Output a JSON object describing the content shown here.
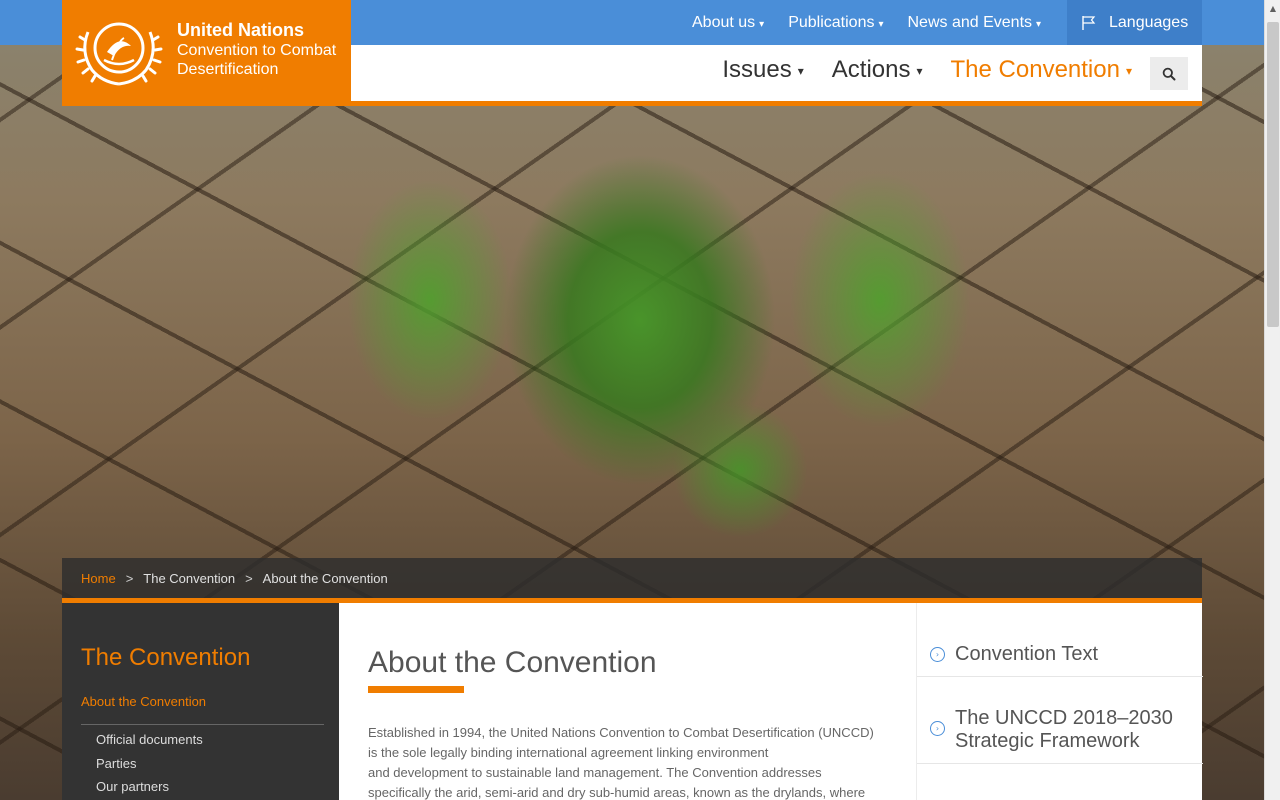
{
  "header": {
    "logo": {
      "line1": "United Nations",
      "line2": "Convention to Combat",
      "line3": "Desertification"
    },
    "top_nav": [
      {
        "label": "About us"
      },
      {
        "label": "Publications"
      },
      {
        "label": "News and Events"
      }
    ],
    "languages_label": "Languages",
    "main_nav": [
      {
        "label": "Issues",
        "active": false
      },
      {
        "label": "Actions",
        "active": false
      },
      {
        "label": "The Convention",
        "active": true
      }
    ]
  },
  "breadcrumb": {
    "items": [
      "Home",
      "The Convention",
      "About the Convention"
    ],
    "separator": ">"
  },
  "sidebar": {
    "title": "The Convention",
    "active_item": "About the Convention",
    "sub_items": [
      "Official documents",
      "Parties",
      "Our partners"
    ]
  },
  "main": {
    "title": "About the Convention",
    "paragraph_lines": [
      "Established in 1994, the United Nations Convention to Combat Desertification (UNCCD)",
      "is the sole legally binding international agreement linking environment",
      "and development to sustainable land management. The Convention addresses",
      "specifically the arid, semi-arid and dry sub-humid areas, known as the drylands, where"
    ]
  },
  "right_column": [
    {
      "label": "Convention Text"
    },
    {
      "label": "The UNCCD 2018–2030 Strategic Framework"
    }
  ],
  "colors": {
    "accent": "#f07d00",
    "topbar": "#4a8ed8",
    "dark_panel": "#333333"
  },
  "icons": {
    "logo": "un-emblem-icon",
    "languages": "flag-icon",
    "search": "search-icon",
    "right_item": "chevron-right-circle-icon"
  }
}
